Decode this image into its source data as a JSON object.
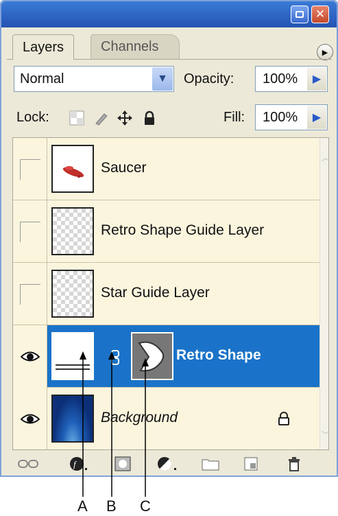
{
  "tabs": [
    "Layers",
    "Channels"
  ],
  "blend_mode": "Normal",
  "opacity": {
    "label": "Opacity:",
    "value": "100%"
  },
  "lock": {
    "label": "Lock:"
  },
  "fill": {
    "label": "Fill:",
    "value": "100%"
  },
  "layers": [
    {
      "name": "Saucer",
      "visible": false,
      "selected": false
    },
    {
      "name": "Retro Shape Guide Layer",
      "visible": false,
      "selected": false
    },
    {
      "name": "Star Guide Layer",
      "visible": false,
      "selected": false
    },
    {
      "name": "Retro Shape",
      "visible": true,
      "selected": true
    },
    {
      "name": "Background",
      "visible": true,
      "selected": false,
      "locked": true
    }
  ],
  "callouts": [
    "A",
    "B",
    "C"
  ],
  "colors": {
    "titlebar": "#2d63c2",
    "selection": "#1a73c8",
    "panel": "#ece9d8",
    "list_bg": "#fbf5de"
  }
}
